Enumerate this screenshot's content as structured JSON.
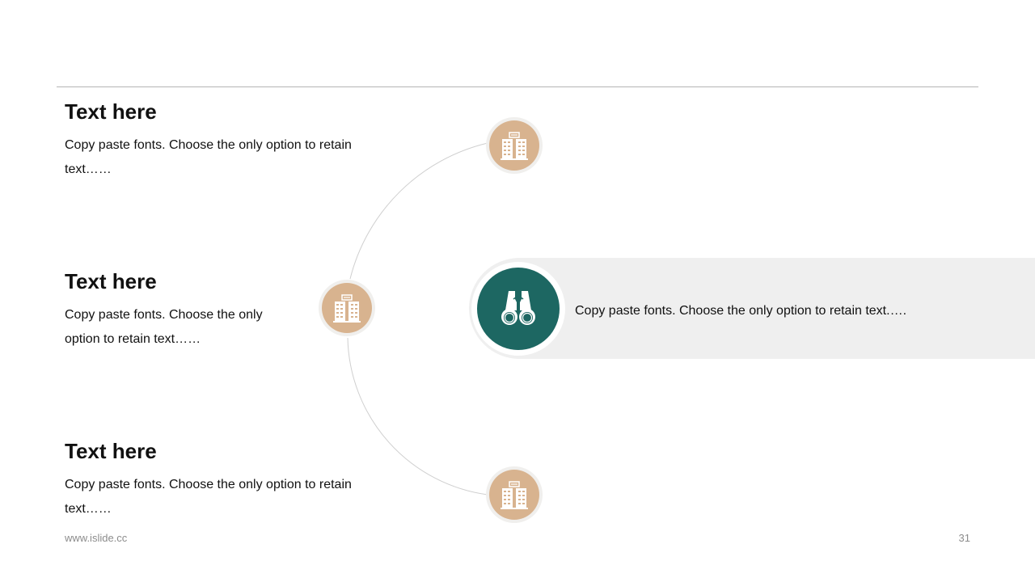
{
  "items": [
    {
      "title": "Text here",
      "body": "Copy paste fonts. Choose the only option to retain text……"
    },
    {
      "title": "Text here",
      "body": "Copy paste fonts. Choose the only option to retain text……"
    },
    {
      "title": "Text here",
      "body": "Copy paste fonts. Choose the only option to retain text……"
    }
  ],
  "highlight": {
    "text": "Copy paste fonts. Choose the only option to retain text.….",
    "icon": "binoculars-icon"
  },
  "icons": {
    "step_icon": "building-icon"
  },
  "colors": {
    "accent_tan": "#d8b38f",
    "accent_teal": "#1d6762",
    "banner_gray": "#efefef",
    "rule_gray": "#b5b5b5"
  },
  "footer": {
    "url": "www.islide.cc",
    "page": "31"
  }
}
